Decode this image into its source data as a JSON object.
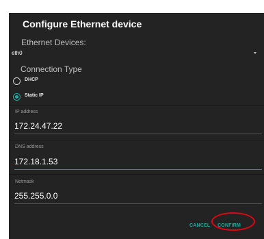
{
  "dialog": {
    "title": "Configure Ethernet device",
    "devices_label": "Ethernet Devices:",
    "device_selected": "eth0",
    "connection_type_label": "Connection Type",
    "options": [
      {
        "label": "DHCP",
        "checked": false
      },
      {
        "label": "Static IP",
        "checked": true
      }
    ],
    "fields": [
      {
        "label": "IP address",
        "value": "172.24.47.22"
      },
      {
        "label": "DNS address",
        "value": "172.18.1.53"
      },
      {
        "label": "Netmask",
        "value": "255.255.0.0"
      }
    ],
    "buttons": {
      "cancel": "CANCEL",
      "confirm": "CONFIRM"
    }
  },
  "colors": {
    "accent": "#1fa7a1",
    "dialog_bg": "#232323",
    "highlight": "#e30613"
  }
}
